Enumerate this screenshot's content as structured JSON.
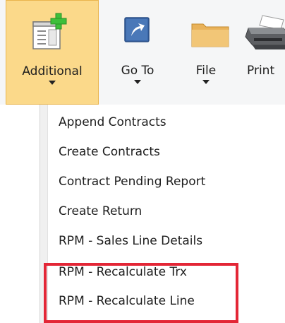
{
  "ribbon": {
    "buttons": [
      {
        "label": "Additional",
        "icon": "additional-icon"
      },
      {
        "label": "Go To",
        "icon": "goto-arrow-icon"
      },
      {
        "label": "File",
        "icon": "folder-icon"
      },
      {
        "label": "Print",
        "icon": "printer-icon"
      }
    ],
    "colors": {
      "active_bg": "#fbd98a",
      "active_border": "#e9b54d",
      "ribbon_bg": "#f5f6f7"
    }
  },
  "menu": {
    "items": [
      {
        "label": "Append Contracts"
      },
      {
        "label": "Create Contracts"
      },
      {
        "label": "Contract Pending Report"
      },
      {
        "label": "Create Return"
      },
      {
        "label": "RPM - Sales Line Details"
      },
      {
        "label": "RPM - Recalculate Trx"
      },
      {
        "label": "RPM - Recalculate Line"
      }
    ],
    "highlight_color": "#e32636"
  }
}
